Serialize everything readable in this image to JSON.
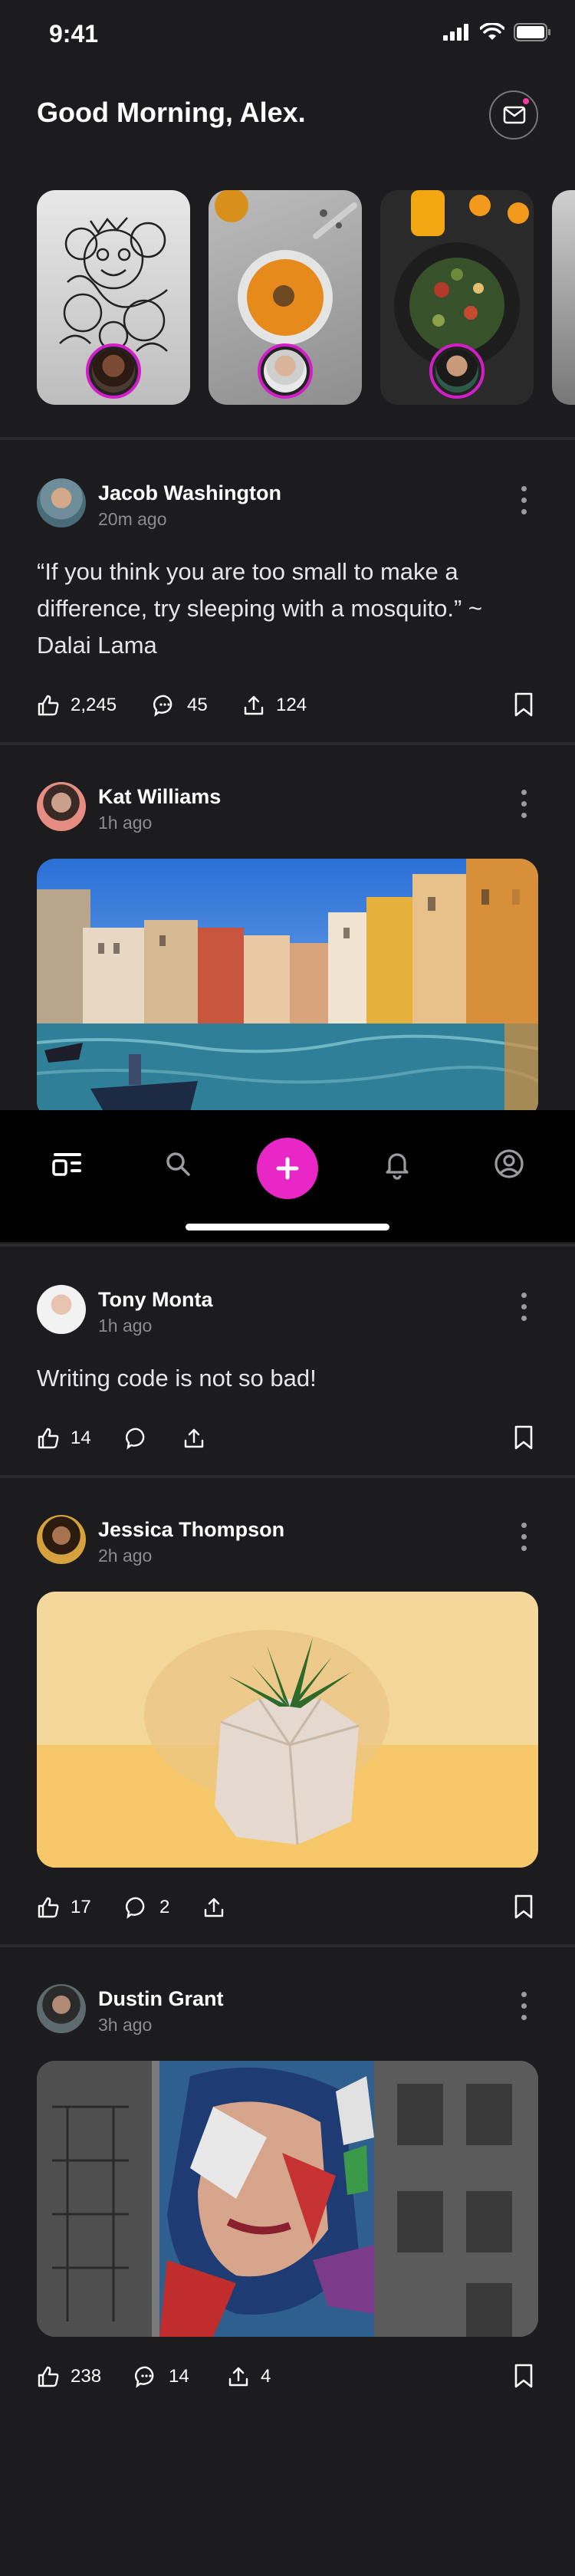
{
  "status": {
    "time": "9:41"
  },
  "header": {
    "greeting": "Good Morning, Alex."
  },
  "icons": {
    "mail": "mail-icon",
    "like": "thumbs-up-icon",
    "comment": "comment-icon",
    "share": "share-icon",
    "bookmark": "bookmark-icon",
    "more": "more-vertical-icon"
  },
  "colors": {
    "accent": "#e926c6",
    "story_ring": "#d31dc7",
    "background": "#1c1c1e"
  },
  "posts": [
    {
      "name": "Jacob Washington",
      "time": "20m ago",
      "text": "“If you think you are too small to make a difference, try sleeping with a mosquito.” ~ Dalai Lama",
      "likes": "2,245",
      "comments": "45",
      "shares": "124"
    },
    {
      "name": "Kat Williams",
      "time": "1h ago"
    },
    {
      "name": "Tony Monta",
      "time": "1h ago",
      "text": "Writing code is not so bad!",
      "likes": "14"
    },
    {
      "name": "Jessica Thompson",
      "time": "2h ago",
      "likes": "17",
      "comments": "2"
    },
    {
      "name": "Dustin Grant",
      "time": "3h ago",
      "likes": "238",
      "comments": "14",
      "shares": "4"
    }
  ],
  "tabbar": {
    "items": [
      "feed-icon",
      "search-icon",
      "add-icon",
      "bell-icon",
      "profile-icon"
    ]
  }
}
